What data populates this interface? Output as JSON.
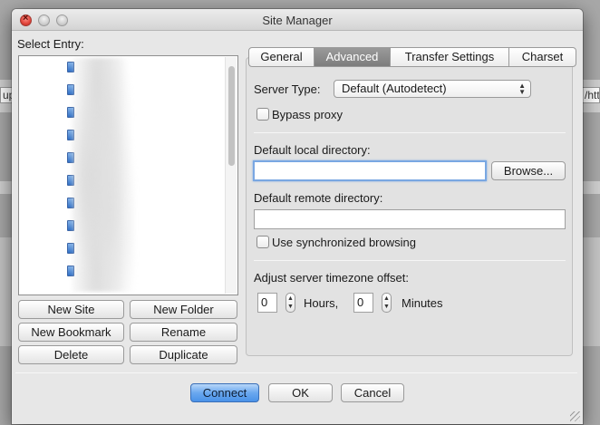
{
  "background": {
    "left_fragment": "up",
    "right_fragment": "/htt"
  },
  "window": {
    "title": "Site Manager"
  },
  "left": {
    "select_entry_label": "Select Entry:",
    "buttons": {
      "new_site": "New Site",
      "new_folder": "New Folder",
      "new_bookmark": "New Bookmark",
      "rename": "Rename",
      "delete": "Delete",
      "duplicate": "Duplicate"
    }
  },
  "tabs": [
    {
      "label": "General",
      "active": false
    },
    {
      "label": "Advanced",
      "active": true
    },
    {
      "label": "Transfer Settings",
      "active": false
    },
    {
      "label": "Charset",
      "active": false
    }
  ],
  "advanced": {
    "server_type_label": "Server Type:",
    "server_type_value": "Default (Autodetect)",
    "bypass_proxy_label": "Bypass proxy",
    "bypass_proxy_checked": false,
    "default_local_dir_label": "Default local directory:",
    "default_local_dir_value": "",
    "browse_label": "Browse...",
    "default_remote_dir_label": "Default remote directory:",
    "default_remote_dir_value": "",
    "sync_browsing_label": "Use synchronized browsing",
    "sync_browsing_checked": false,
    "timezone_label": "Adjust server timezone offset:",
    "hours_value": "0",
    "hours_label": "Hours,",
    "minutes_value": "0",
    "minutes_label": "Minutes"
  },
  "footer": {
    "connect": "Connect",
    "ok": "OK",
    "cancel": "Cancel"
  },
  "colors": {
    "default_button": "#5b9cec",
    "active_tab": "#8a8a8a",
    "focus_ring": "#79a7e2"
  }
}
